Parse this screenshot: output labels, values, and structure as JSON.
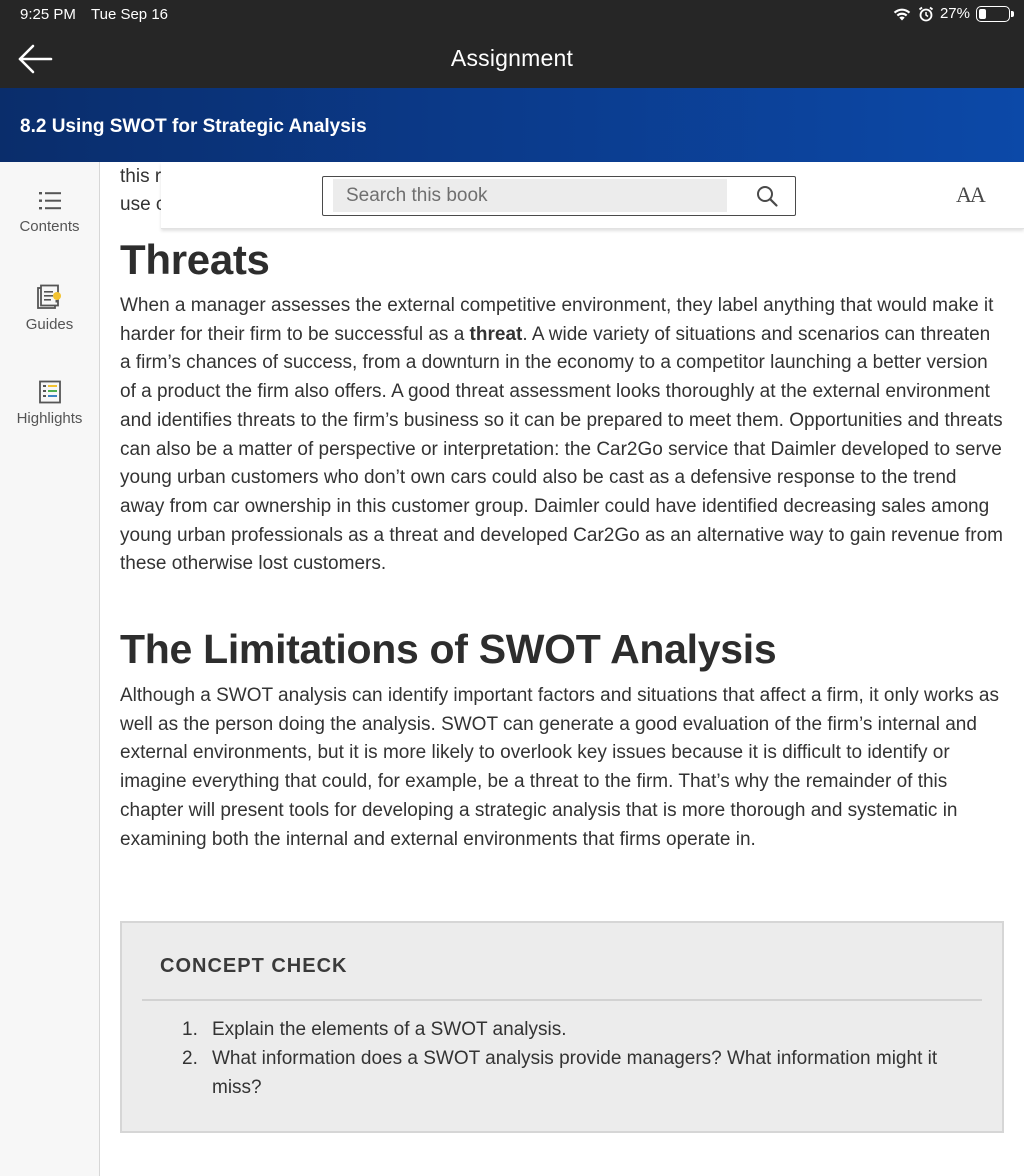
{
  "status_bar": {
    "time": "9:25 PM",
    "date": "Tue Sep 16",
    "battery_percent": "27%",
    "battery_level": 0.27
  },
  "nav": {
    "title": "Assignment",
    "back_icon": "arrow-left-icon"
  },
  "chapter": {
    "title": "8.2 Using SWOT for Strategic Analysis"
  },
  "sidebar": {
    "items": [
      {
        "label": "Contents",
        "icon": "list-icon"
      },
      {
        "label": "Guides",
        "icon": "guide-lightbulb-icon"
      },
      {
        "label": "Highlights",
        "icon": "highlights-list-icon"
      }
    ]
  },
  "search": {
    "placeholder": "Search this book",
    "value": "",
    "font_button_label": "AA"
  },
  "content": {
    "peek_line_1": "this r",
    "peek_line_2": "use c",
    "threats_heading": "Threats",
    "threats_para_before": "When a manager assesses the external competitive environment, they label anything that would make it harder for their firm to be successful as a ",
    "threats_para_bold": "threat",
    "threats_para_after": ". A wide variety of situations and scenarios can threaten a firm’s chances of success, from a downturn in the economy to a competitor launching a better version of a product the firm also offers. A good threat assessment looks thoroughly at the external environment and identifies threats to the firm’s business so it can be prepared to meet them. Opportunities and threats can also be a matter of perspective or interpretation: the Car2Go service that Daimler developed to serve young urban customers who don’t own cars could also be cast as a defensive response to the trend away from car ownership in this customer group. Daimler could have identified decreasing sales among young urban professionals as a threat and developed Car2Go as an alternative way to gain revenue from these otherwise lost customers.",
    "limitations_heading": "The Limitations of SWOT Analysis",
    "limitations_para": "Although a SWOT analysis can identify important factors and situations that affect a firm, it only works as well as the person doing the analysis. SWOT can generate a good evaluation of the firm’s internal and external environments, but it is more likely to overlook key issues because it is difficult to identify or imagine everything that could, for example, be a threat to the firm. That’s why the remainder of this chapter will present tools for developing a strategic analysis that is more thorough and systematic in examining both the internal and external environments that firms operate in."
  },
  "concept_check": {
    "title": "CONCEPT CHECK",
    "items": [
      {
        "num": "1.",
        "text": "Explain the elements of a SWOT analysis."
      },
      {
        "num": "2.",
        "text": "What information does a SWOT analysis provide managers? What information might it miss?"
      }
    ]
  }
}
